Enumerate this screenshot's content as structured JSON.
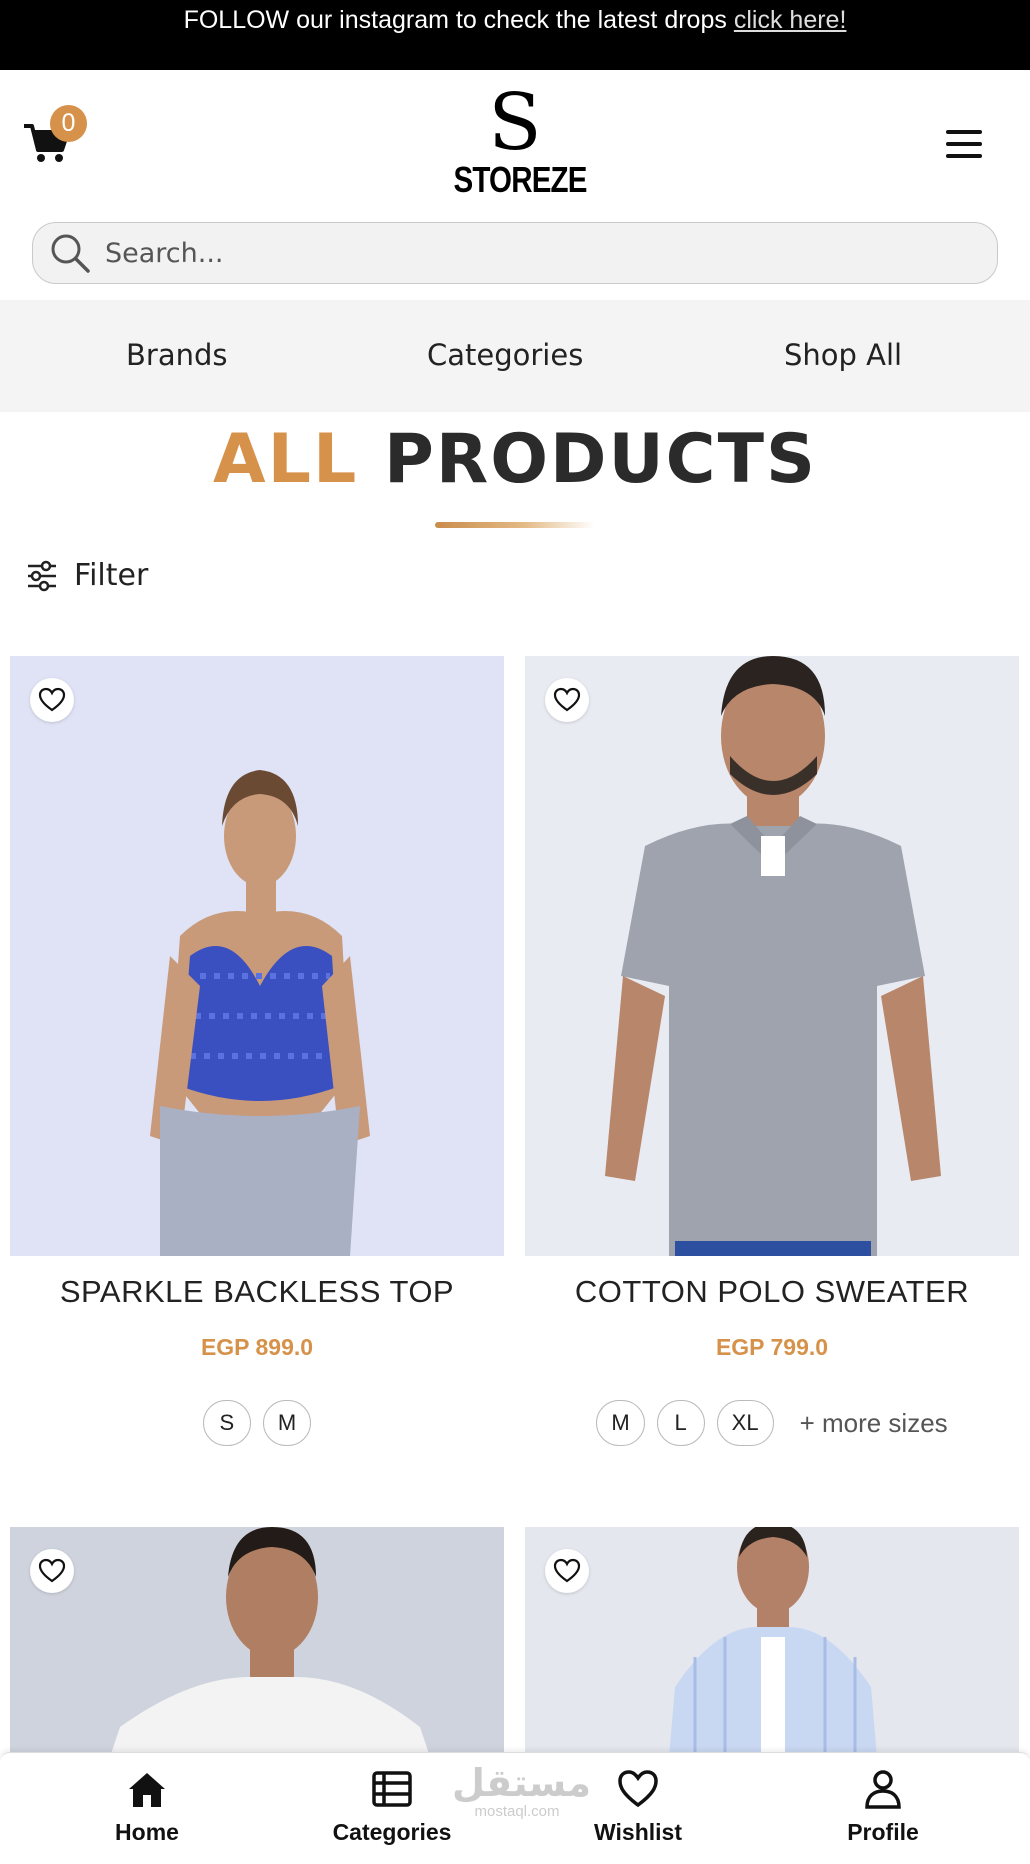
{
  "announcement": {
    "text": "FOLLOW our instagram to check the latest drops",
    "link": "click here!"
  },
  "header": {
    "cart_count": "0",
    "logo_letter": "S",
    "logo_name": "STOREZE"
  },
  "search": {
    "placeholder": "Search..."
  },
  "nav": {
    "brands": "Brands",
    "categories": "Categories",
    "shop_all": "Shop All"
  },
  "page_title": {
    "part1": "ALL",
    "part2": "PRODUCTS"
  },
  "filter_label": "Filter",
  "products": [
    {
      "name": "SPARKLE BACKLESS TOP",
      "price": "EGP 899.0",
      "sizes": [
        "S",
        "M"
      ]
    },
    {
      "name": "COTTON POLO SWEATER",
      "price": "EGP 799.0",
      "sizes": [
        "M",
        "L",
        "XL"
      ],
      "more_sizes": "+ more sizes"
    }
  ],
  "bottom_nav": {
    "home": "Home",
    "categories": "Categories",
    "wishlist": "Wishlist",
    "profile": "Profile"
  },
  "watermark": {
    "arabic": "مستقل",
    "latin": "mostaql.com"
  },
  "colors": {
    "accent": "#d6924a",
    "dark": "#2b2b2b",
    "topbar": "#000000"
  }
}
